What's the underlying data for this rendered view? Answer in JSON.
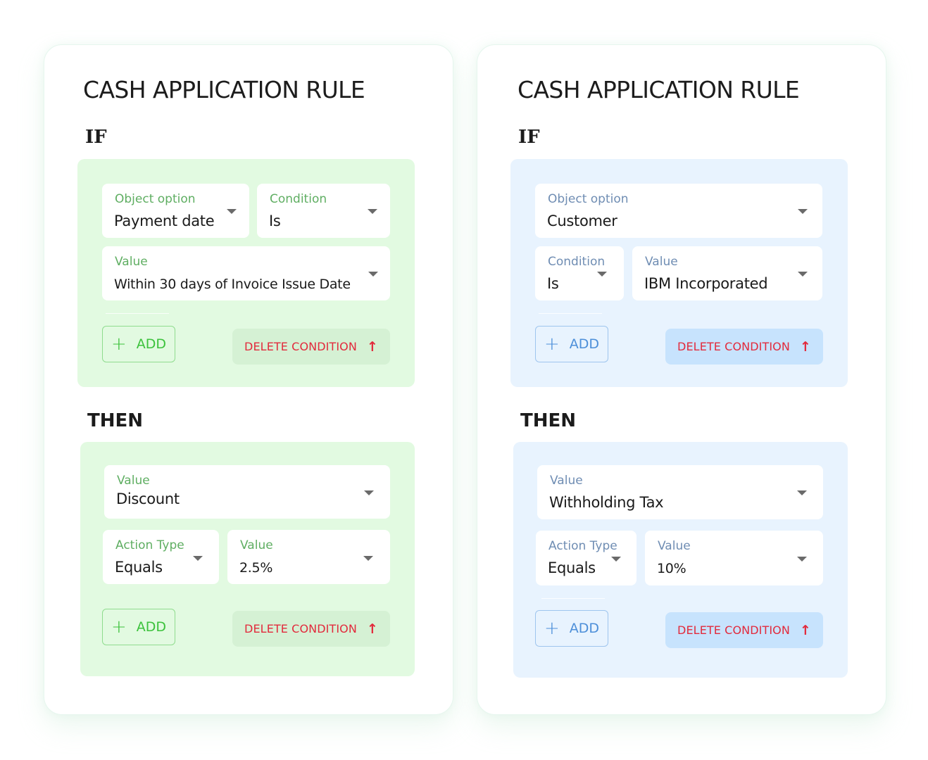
{
  "rules": [
    {
      "theme": "green",
      "title": "CASH APPLICATION RULE",
      "if_label": "IF",
      "then_label": "THEN",
      "if_section": {
        "fields": [
          {
            "label": "Object option",
            "value": "Payment date",
            "icon": "caret-down-icon"
          },
          {
            "label": "Condition",
            "value": "Is",
            "icon": "caret-down-icon"
          },
          {
            "label": "Value",
            "value": "Within 30 days of Invoice Issue Date",
            "icon": "caret-down-icon"
          }
        ],
        "add_label": "ADD",
        "add_icon": "plus-icon",
        "delete_label": "DELETE CONDITION",
        "delete_icon": "arrow-up-icon"
      },
      "then_section": {
        "fields": [
          {
            "label": "Value",
            "value": "Discount",
            "icon": "caret-down-icon"
          },
          {
            "label": "Action Type",
            "value": "Equals",
            "icon": "caret-down-icon"
          },
          {
            "label": "Value",
            "value": "2.5%",
            "icon": "caret-down-icon"
          }
        ],
        "add_label": "ADD",
        "add_icon": "plus-icon",
        "delete_label": "DELETE CONDITION",
        "delete_icon": "arrow-up-icon"
      }
    },
    {
      "theme": "blue",
      "title": "CASH APPLICATION RULE",
      "if_label": "IF",
      "then_label": "THEN",
      "if_section": {
        "fields": [
          {
            "label": "Object option",
            "value": "Customer",
            "icon": "caret-down-icon"
          },
          {
            "label": "Condition",
            "value": "Is",
            "icon": "caret-down-icon"
          },
          {
            "label": "Value",
            "value": "IBM Incorporated",
            "icon": "caret-down-icon"
          }
        ],
        "add_label": "ADD",
        "add_icon": "plus-icon",
        "delete_label": "DELETE CONDITION",
        "delete_icon": "arrow-up-icon"
      },
      "then_section": {
        "fields": [
          {
            "label": "Value",
            "value": "Withholding Tax",
            "icon": "caret-down-icon"
          },
          {
            "label": "Action Type",
            "value": "Equals",
            "icon": "caret-down-icon"
          },
          {
            "label": "Value",
            "value": "10%",
            "icon": "caret-down-icon"
          }
        ],
        "add_label": "ADD",
        "add_icon": "plus-icon",
        "delete_label": "DELETE CONDITION",
        "delete_icon": "arrow-up-icon"
      }
    }
  ],
  "icons": {
    "plus": "+",
    "arrow_up": "↑"
  },
  "colors": {
    "green_panel": "#e2fae1",
    "blue_panel": "#e8f3fe",
    "green_accent": "#3cc23c",
    "blue_accent": "#4d8fd9",
    "delete_text": "#e22a3c"
  }
}
